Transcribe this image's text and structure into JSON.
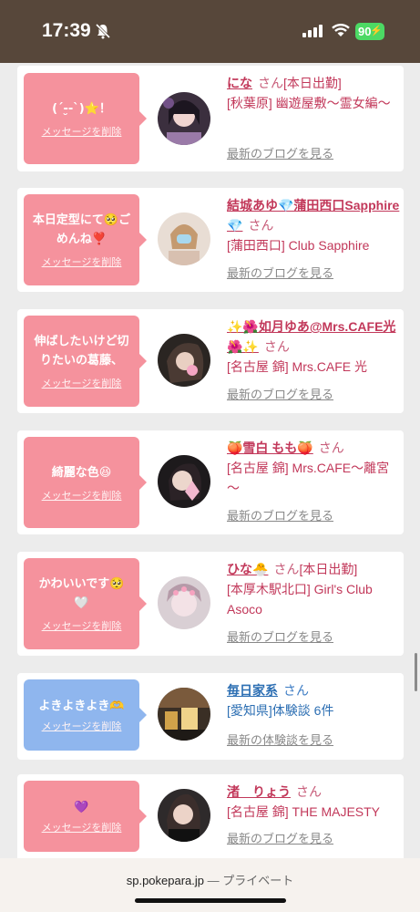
{
  "status_bar": {
    "time": "17:39",
    "battery": "90",
    "icons": [
      "bell-mute-icon",
      "signal-icon",
      "wifi-icon",
      "battery-icon"
    ]
  },
  "colors": {
    "status_bg": "#57473a",
    "bubble_pink": "#f5929d",
    "bubble_blue": "#8fb6ee",
    "name_pink": "#c2385a",
    "name_blue": "#2d6fb3"
  },
  "cards": [
    {
      "bubble_lines": [
        "(´-̮-`)⭐！"
      ],
      "delete_label": "メッセージを削除",
      "name": "にな",
      "san": "さん",
      "status": "[本日出勤]",
      "shop": "[秋葉原] 幽遊屋敷～霊女編～",
      "link": "最新のブログを見る"
    },
    {
      "bubble_lines": [
        "本日定型にて🥺ご",
        "めんね❣️"
      ],
      "delete_label": "メッセージを削除",
      "name": "結城あゆ💎蒲田西口Sapphire💎",
      "san": "さん",
      "status": "",
      "shop": "[蒲田西口] Club Sapphire",
      "link": "最新のブログを見る"
    },
    {
      "bubble_lines": [
        "伸ばしたいけど切",
        "りたいの葛藤、"
      ],
      "delete_label": "メッセージを削除",
      "name": "✨🌺如月ゆあ@Mrs.CAFE光🌺✨",
      "san": "さん",
      "status": "",
      "shop": "[名古屋 錦] Mrs.CAFE 光",
      "link": "最新のブログを見る"
    },
    {
      "bubble_lines": [
        "綺麗な色😆"
      ],
      "delete_label": "メッセージを削除",
      "name": "🍑雪白 もも🍑",
      "san": "さん",
      "status": "",
      "shop": "[名古屋 錦] Mrs.CAFE～離宮～",
      "link": "最新のブログを見る"
    },
    {
      "bubble_lines": [
        "かわいいです🥺",
        "🤍"
      ],
      "delete_label": "メッセージを削除",
      "name": "ひな🐣",
      "san": "さん",
      "status": "[本日出勤]",
      "shop": "[本厚木駅北口] Girl's Club Asoco",
      "link": "最新のブログを見る"
    },
    {
      "bubble_lines": [
        "よきよきよき🫶"
      ],
      "delete_label": "メッセージを削除",
      "name": "毎日家系",
      "san": "さん",
      "status": "",
      "shop": "[愛知県]体験談 6件",
      "link": "最新の体験談を見る"
    },
    {
      "bubble_lines": [
        "💜"
      ],
      "delete_label": "メッセージを削除",
      "name": "渚　りょう",
      "san": "さん",
      "status": "",
      "shop": "[名古屋 錦] THE MAJESTY",
      "link": "最新のブログを見る"
    }
  ],
  "url_bar": {
    "domain": "sp.pokepara.jp",
    "separator": " — ",
    "mode": "プライベート"
  }
}
